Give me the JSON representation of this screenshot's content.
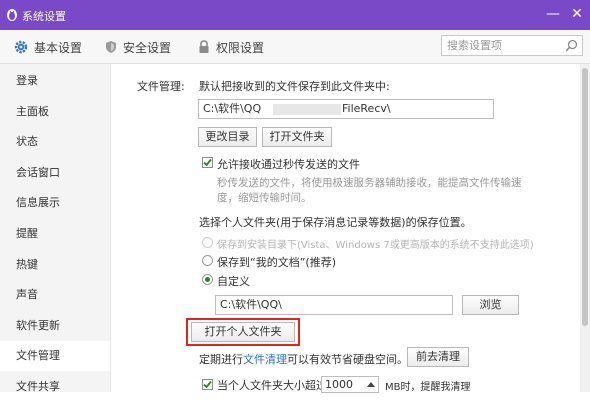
{
  "window": {
    "title": "系统设置",
    "minimize_glyph": "—",
    "close_glyph": "✕"
  },
  "tabs": [
    {
      "label": "基本设置",
      "icon": "gear-icon"
    },
    {
      "label": "安全设置",
      "icon": "shield-icon"
    },
    {
      "label": "权限设置",
      "icon": "lock-icon"
    }
  ],
  "search": {
    "placeholder": "搜索设置项"
  },
  "sidebar": {
    "items": [
      {
        "label": "登录"
      },
      {
        "label": "主面板"
      },
      {
        "label": "状态"
      },
      {
        "label": "会话窗口"
      },
      {
        "label": "信息展示"
      },
      {
        "label": "提醒"
      },
      {
        "label": "热键"
      },
      {
        "label": "声音"
      },
      {
        "label": "软件更新"
      },
      {
        "label": "文件管理"
      },
      {
        "label": "文件共享"
      }
    ],
    "active": "文件管理"
  },
  "file_management": {
    "section_label": "文件管理:",
    "default_save_text": "默认把接收到的文件保存到此文件夹中:",
    "path_prefix": "C:\\软件\\QQ",
    "path_suffix": "FileRecv\\",
    "change_dir_button": "更改目录",
    "open_folder_button": "打开文件夹",
    "fast_transfer_checkbox": "允许接收通过秒传发送的文件",
    "fast_transfer_desc_line1": "秒传发送的文件，将使用极速服务器辅助接收，能提高文件传输速",
    "fast_transfer_desc_line2": "度，缩短传输时间。",
    "personal_folder_text": "选择个人文件夹(用于保存消息记录等数据)的保存位置。",
    "radio_install_dir": "保存到安装目录下(Vista、Windows 7或更高版本的系统不支持此选项)",
    "radio_my_documents": "保存到“我的文档”(推荐)",
    "radio_custom": "自定义",
    "custom_path": "C:\\软件\\QQ\\",
    "browse_button": "浏览",
    "open_personal_folder_button": "打开个人文件夹",
    "cleanup_prefix": "定期进行",
    "cleanup_link": "文件清理",
    "cleanup_suffix": "可以有效节省硬盘空间。",
    "cleanup_button": "前去清理",
    "size_prefix": "当个人文件夹大小超过",
    "size_value": "1000",
    "size_unit": "MB时，提醒我清理"
  },
  "colors": {
    "titlebar": "#7a49c7",
    "highlight": "#e0261b",
    "link": "#2a6fd1",
    "check": "#2f7d32"
  }
}
